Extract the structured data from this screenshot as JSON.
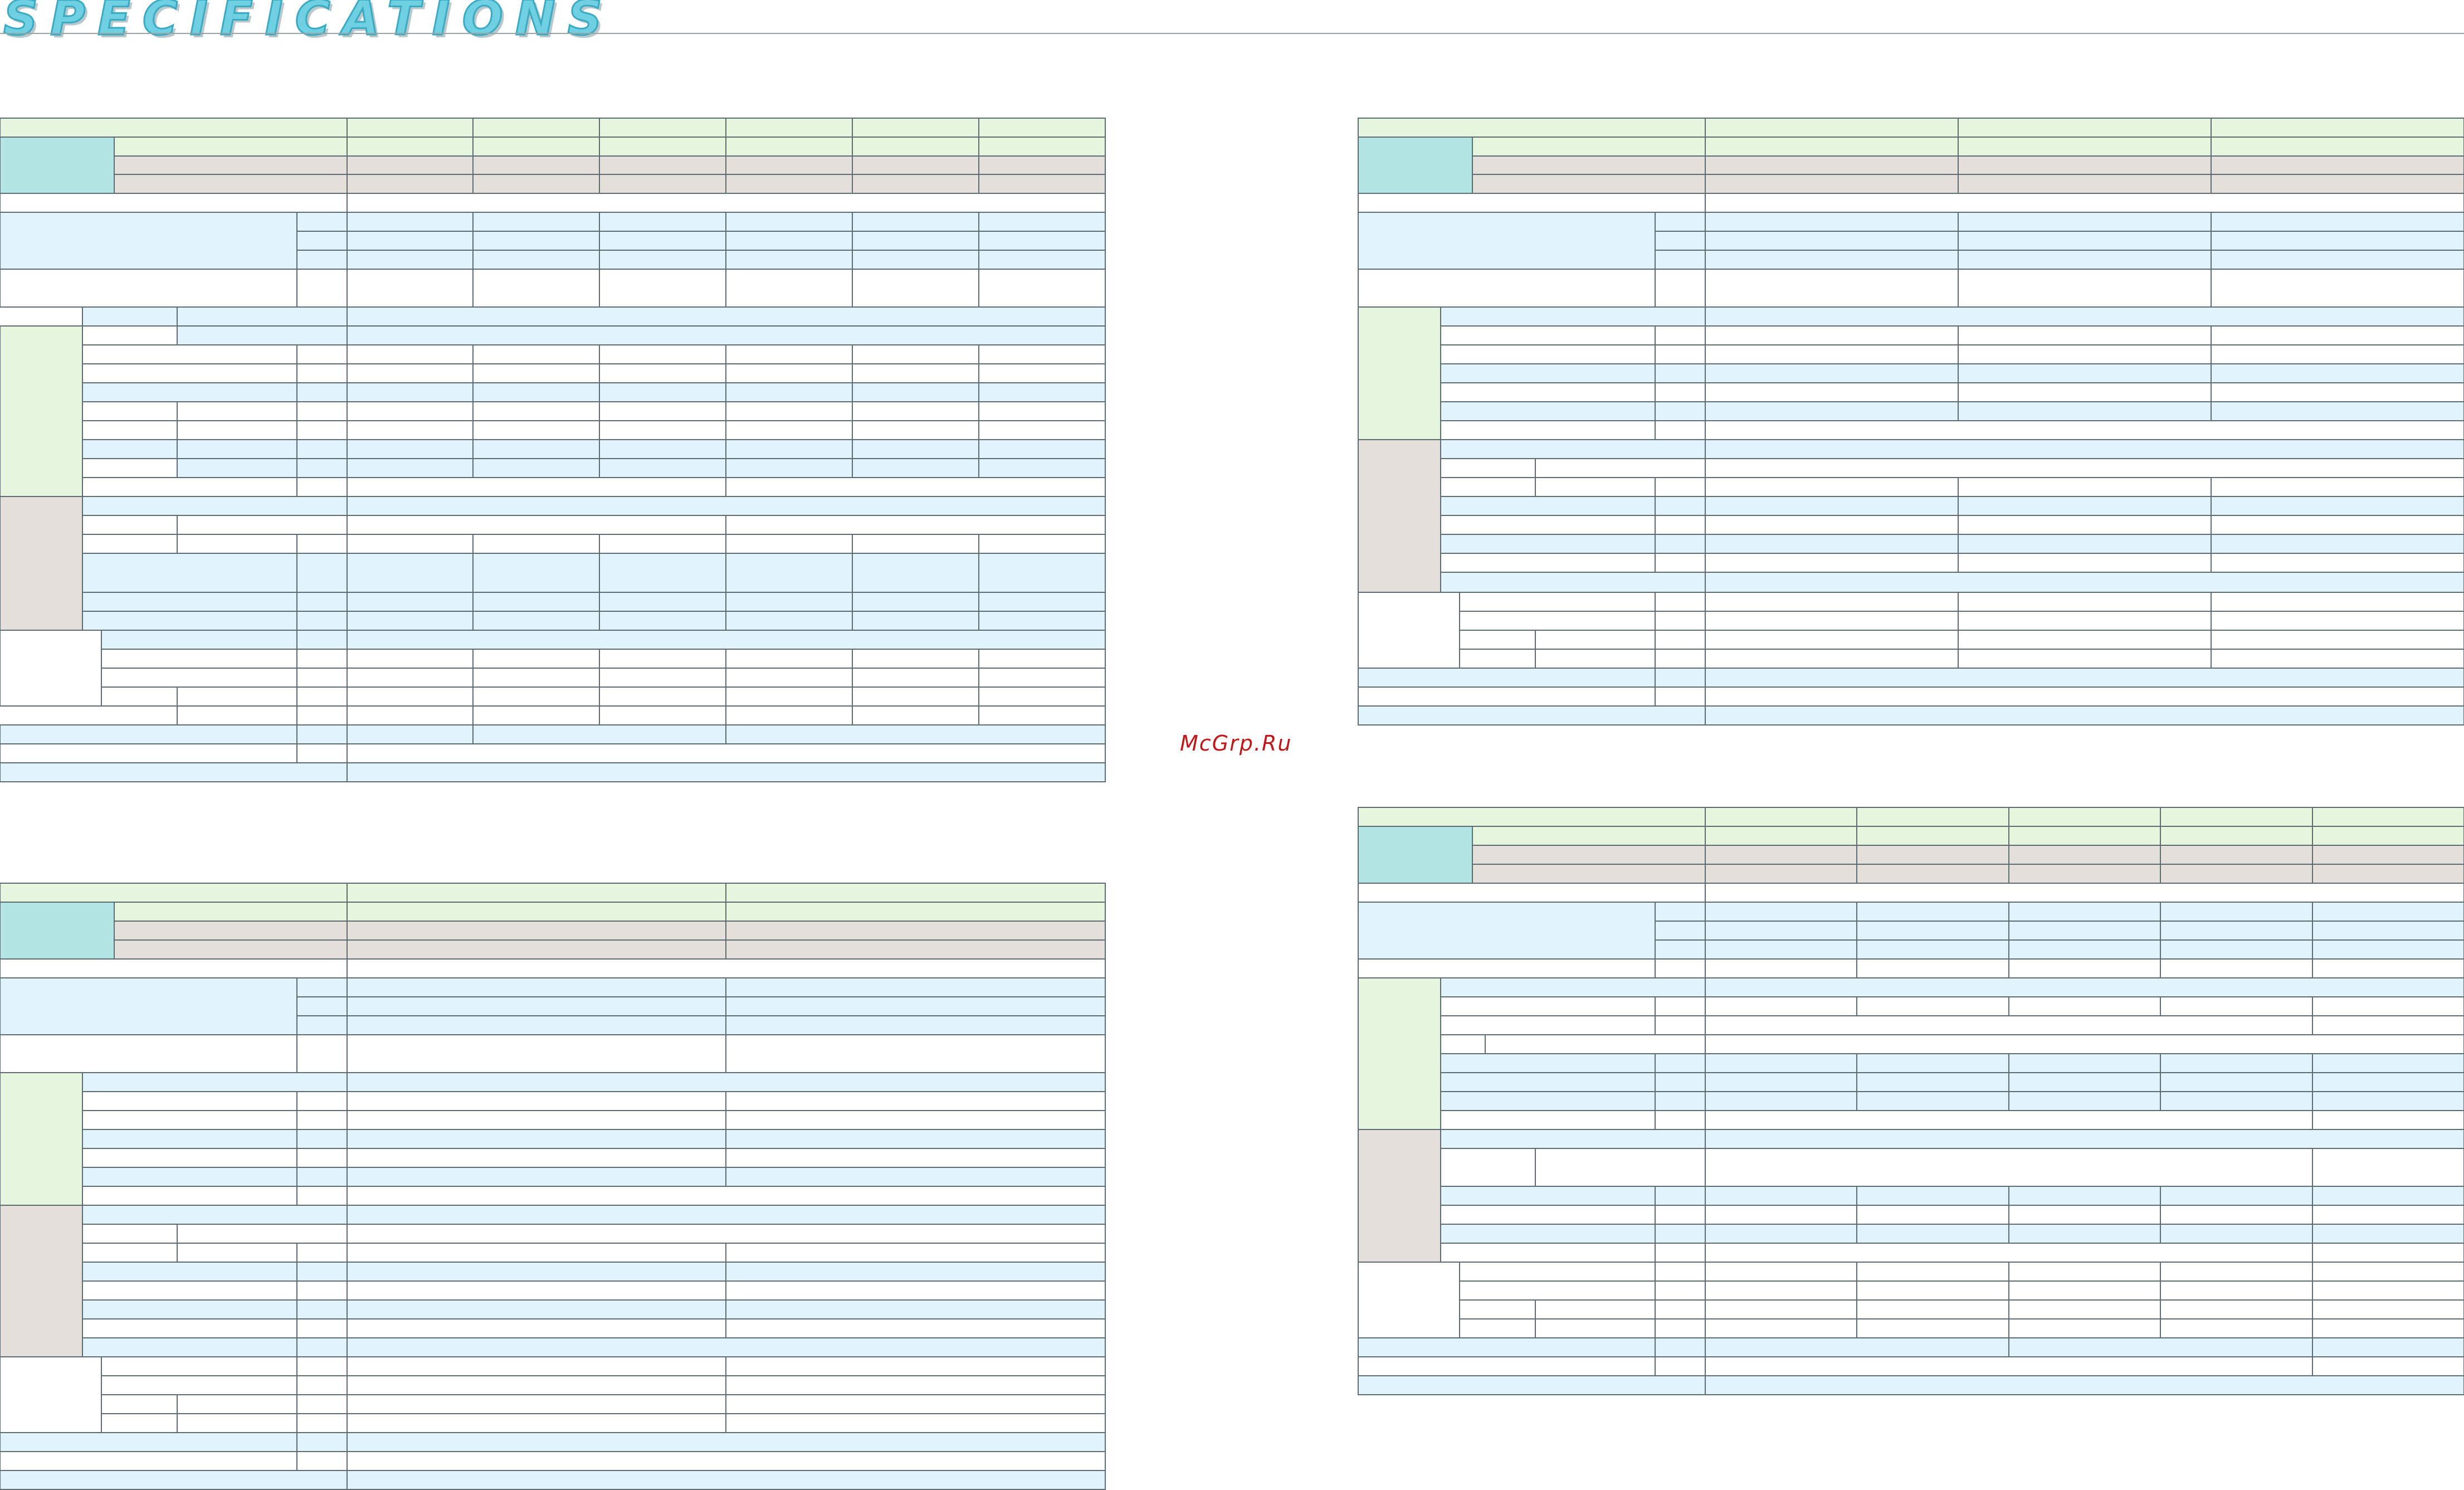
{
  "page": {
    "title": "SPECIFICATIONS",
    "watermark": "McGrp.Ru"
  },
  "colors": {
    "green_band": "#e6f5de",
    "teal_block": "#b4e5e5",
    "taupe_block": "#e4dfdb",
    "blue_band": "#e2f4fb",
    "white": "#ffffff",
    "grid_line": "#5e6d73",
    "title_fill": "#6fd0e2",
    "title_outline": "#3aa9c2",
    "watermark": "#c01818"
  },
  "tables": [
    {
      "id": "table-1",
      "model_columns": 6
    },
    {
      "id": "table-2",
      "model_columns": 2
    },
    {
      "id": "table-3",
      "model_columns": 3
    },
    {
      "id": "table-4",
      "model_columns": 5
    }
  ]
}
